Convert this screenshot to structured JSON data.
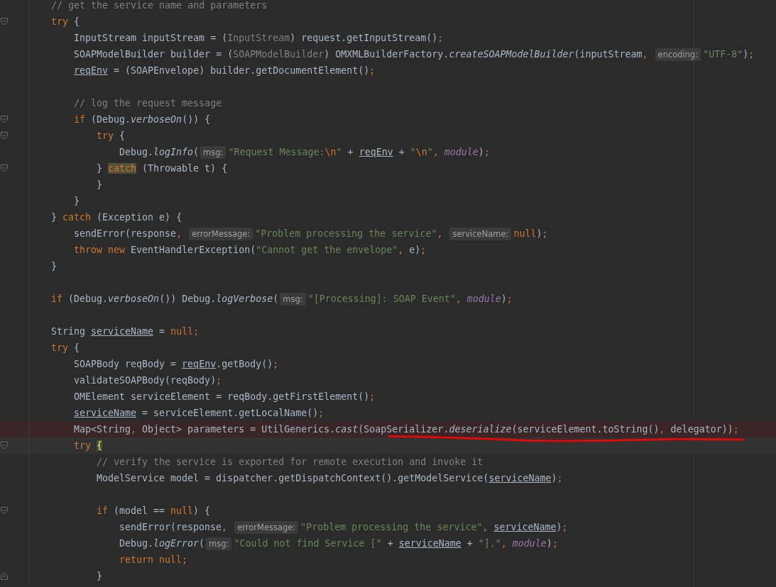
{
  "editor": {
    "lines": [
      {
        "kind": "code",
        "tokens": [
          {
            "kind": "comment",
            "text": "// get the service name and parameters"
          }
        ]
      },
      {
        "kind": "code",
        "fold_open": true,
        "tokens": [
          {
            "kind": "keyword",
            "text": "try"
          },
          {
            "kind": "plain",
            "text": " {"
          }
        ],
        "children": [
          {
            "kind": "code",
            "tokens": [
              {
                "kind": "plain",
                "text": "InputStream inputStream = ("
              },
              {
                "kind": "cast",
                "text": "InputStream"
              },
              {
                "kind": "plain",
                "text": ") request.getInputStream()"
              },
              {
                "kind": "punct",
                "text": ";"
              }
            ]
          },
          {
            "kind": "code",
            "tokens": [
              {
                "kind": "plain",
                "text": "SOAPModelBuilder builder = ("
              },
              {
                "kind": "cast",
                "text": "SOAPModelBuilder"
              },
              {
                "kind": "plain",
                "text": ") OMXMLBuilderFactory."
              },
              {
                "kind": "method",
                "text": "createSOAPModelBuilder"
              },
              {
                "kind": "plain",
                "text": "(inputStream"
              },
              {
                "kind": "punct",
                "text": ", "
              },
              {
                "kind": "hint",
                "text": "encoding:"
              },
              {
                "kind": "string",
                "text": "\"UTF-8\""
              },
              {
                "kind": "plain",
                "text": ")"
              },
              {
                "kind": "punct",
                "text": ";"
              }
            ]
          },
          {
            "kind": "code",
            "tokens": [
              {
                "kind": "underlined",
                "text": "reqEnv"
              },
              {
                "kind": "plain",
                "text": " = (SOAPEnvelope) builder.getDocumentElement()"
              },
              {
                "kind": "punct",
                "text": ";"
              }
            ]
          },
          {
            "kind": "blank"
          },
          {
            "kind": "code",
            "tokens": [
              {
                "kind": "comment",
                "text": "// log the request message"
              }
            ]
          },
          {
            "kind": "code",
            "fold_open": true,
            "tokens": [
              {
                "kind": "keyword",
                "text": "if"
              },
              {
                "kind": "plain",
                "text": " (Debug."
              },
              {
                "kind": "method",
                "text": "verboseOn"
              },
              {
                "kind": "plain",
                "text": "()) {"
              }
            ],
            "children": [
              {
                "kind": "code",
                "fold_open": true,
                "tokens": [
                  {
                    "kind": "keyword",
                    "text": "try"
                  },
                  {
                    "kind": "plain",
                    "text": " {"
                  }
                ],
                "children": [
                  {
                    "kind": "code",
                    "tokens": [
                      {
                        "kind": "plain",
                        "text": "Debug."
                      },
                      {
                        "kind": "method",
                        "text": "logInfo"
                      },
                      {
                        "kind": "plain",
                        "text": "("
                      },
                      {
                        "kind": "hint",
                        "text": "msg:"
                      },
                      {
                        "kind": "string",
                        "text": "\"Request Message:"
                      },
                      {
                        "kind": "escape",
                        "text": "\\n"
                      },
                      {
                        "kind": "string",
                        "text": "\""
                      },
                      {
                        "kind": "plain",
                        "text": " + "
                      },
                      {
                        "kind": "underlined",
                        "text": "reqEnv"
                      },
                      {
                        "kind": "plain",
                        "text": " + "
                      },
                      {
                        "kind": "string",
                        "text": "\""
                      },
                      {
                        "kind": "escape",
                        "text": "\\n"
                      },
                      {
                        "kind": "string",
                        "text": "\""
                      },
                      {
                        "kind": "punct",
                        "text": ", "
                      },
                      {
                        "kind": "field",
                        "text": "module"
                      },
                      {
                        "kind": "plain",
                        "text": ")"
                      },
                      {
                        "kind": "punct",
                        "text": ";"
                      }
                    ]
                  }
                ]
              },
              {
                "kind": "code",
                "fold_open": true,
                "tokens": [
                  {
                    "kind": "plain",
                    "text": "} "
                  },
                  {
                    "kind": "marked",
                    "text": "catch"
                  },
                  {
                    "kind": "plain",
                    "text": " (Throwable t) {"
                  }
                ]
              },
              {
                "kind": "code",
                "tokens": [
                  {
                    "kind": "plain",
                    "text": "}"
                  }
                ]
              }
            ]
          },
          {
            "kind": "code",
            "tokens": [
              {
                "kind": "plain",
                "text": "}"
              }
            ]
          }
        ]
      },
      {
        "kind": "code",
        "tokens": [
          {
            "kind": "plain",
            "text": "} "
          },
          {
            "kind": "keyword",
            "text": "catch"
          },
          {
            "kind": "plain",
            "text": " (Exception e) {"
          }
        ],
        "children": [
          {
            "kind": "code",
            "tokens": [
              {
                "kind": "plain",
                "text": "sendError(response"
              },
              {
                "kind": "punct",
                "text": ", "
              },
              {
                "kind": "hint",
                "text": "errorMessage:"
              },
              {
                "kind": "string",
                "text": "\"Problem processing the service\""
              },
              {
                "kind": "punct",
                "text": ", "
              },
              {
                "kind": "hint",
                "text": "serviceName:"
              },
              {
                "kind": "keyword",
                "text": "null"
              },
              {
                "kind": "plain",
                "text": ")"
              },
              {
                "kind": "punct",
                "text": ";"
              }
            ]
          },
          {
            "kind": "code",
            "tokens": [
              {
                "kind": "keyword",
                "text": "throw new"
              },
              {
                "kind": "plain",
                "text": " EventHandlerException("
              },
              {
                "kind": "string",
                "text": "\"Cannot get the envelope\""
              },
              {
                "kind": "punct",
                "text": ", "
              },
              {
                "kind": "plain",
                "text": "e)"
              },
              {
                "kind": "punct",
                "text": ";"
              }
            ]
          }
        ]
      },
      {
        "kind": "code",
        "tokens": [
          {
            "kind": "plain",
            "text": "}"
          }
        ]
      },
      {
        "kind": "blank"
      },
      {
        "kind": "code",
        "tokens": [
          {
            "kind": "keyword",
            "text": "if"
          },
          {
            "kind": "plain",
            "text": " (Debug."
          },
          {
            "kind": "method",
            "text": "verboseOn"
          },
          {
            "kind": "plain",
            "text": "()) Debug."
          },
          {
            "kind": "method",
            "text": "logVerbose"
          },
          {
            "kind": "plain",
            "text": "("
          },
          {
            "kind": "hint",
            "text": "msg:"
          },
          {
            "kind": "string",
            "text": "\"[Processing]: SOAP Event\""
          },
          {
            "kind": "punct",
            "text": ", "
          },
          {
            "kind": "field",
            "text": "module"
          },
          {
            "kind": "plain",
            "text": ")"
          },
          {
            "kind": "punct",
            "text": ";"
          }
        ]
      },
      {
        "kind": "blank"
      },
      {
        "kind": "code",
        "tokens": [
          {
            "kind": "plain",
            "text": "String "
          },
          {
            "kind": "underlined",
            "text": "serviceName"
          },
          {
            "kind": "plain",
            "text": " = "
          },
          {
            "kind": "keyword",
            "text": "null"
          },
          {
            "kind": "punct",
            "text": ";"
          }
        ]
      },
      {
        "kind": "code",
        "tokens": [
          {
            "kind": "keyword",
            "text": "try"
          },
          {
            "kind": "plain",
            "text": " {"
          }
        ],
        "children": [
          {
            "kind": "code",
            "tokens": [
              {
                "kind": "plain",
                "text": "SOAPBody reqBody = "
              },
              {
                "kind": "underlined",
                "text": "reqEnv"
              },
              {
                "kind": "plain",
                "text": ".getBody()"
              },
              {
                "kind": "punct",
                "text": ";"
              }
            ]
          },
          {
            "kind": "code",
            "tokens": [
              {
                "kind": "plain",
                "text": "validateSOAPBody(reqBody)"
              },
              {
                "kind": "punct",
                "text": ";"
              }
            ]
          },
          {
            "kind": "code",
            "tokens": [
              {
                "kind": "plain",
                "text": "OMElement serviceElement = reqBody.getFirstElement()"
              },
              {
                "kind": "punct",
                "text": ";"
              }
            ]
          },
          {
            "kind": "code",
            "tokens": [
              {
                "kind": "underlined",
                "text": "serviceName"
              },
              {
                "kind": "plain",
                "text": " = serviceElement.getLocalName()"
              },
              {
                "kind": "punct",
                "text": ";"
              }
            ]
          },
          {
            "kind": "error",
            "tokens": [
              {
                "kind": "plain",
                "text": "Map<String"
              },
              {
                "kind": "punct",
                "text": ", "
              },
              {
                "kind": "plain",
                "text": "Object> parameters = UtilGenerics."
              },
              {
                "kind": "method",
                "text": "cast"
              },
              {
                "kind": "plain",
                "text": "(SoapSerializer."
              },
              {
                "kind": "method",
                "text": "deserialize"
              },
              {
                "kind": "plain",
                "text": "(serviceElement.toString()"
              },
              {
                "kind": "punct",
                "text": ", "
              },
              {
                "kind": "plain",
                "text": "delegator))"
              },
              {
                "kind": "punct",
                "text": ";"
              }
            ]
          },
          {
            "kind": "current",
            "fold_open": true,
            "tokens": [
              {
                "kind": "keyword",
                "text": "try"
              },
              {
                "kind": "brace",
                "text": "{"
              }
            ],
            "children": [
              {
                "kind": "code",
                "tokens": [
                  {
                    "kind": "comment",
                    "text": "// verify the service is exported for remote execution and invoke it"
                  }
                ]
              },
              {
                "kind": "code",
                "tokens": [
                  {
                    "kind": "plain",
                    "text": "ModelService model = dispatcher.getDispatchContext().getModelService("
                  },
                  {
                    "kind": "underlined",
                    "text": "serviceName"
                  },
                  {
                    "kind": "plain",
                    "text": ")"
                  },
                  {
                    "kind": "punct",
                    "text": ";"
                  }
                ]
              },
              {
                "kind": "blank"
              },
              {
                "kind": "code",
                "fold_open": true,
                "tokens": [
                  {
                    "kind": "keyword",
                    "text": "if"
                  },
                  {
                    "kind": "plain",
                    "text": " (model == "
                  },
                  {
                    "kind": "keyword",
                    "text": "null"
                  },
                  {
                    "kind": "plain",
                    "text": ") {"
                  }
                ],
                "children": [
                  {
                    "kind": "code",
                    "tokens": [
                      {
                        "kind": "plain",
                        "text": "sendError(response"
                      },
                      {
                        "kind": "punct",
                        "text": ", "
                      },
                      {
                        "kind": "hint",
                        "text": "errorMessage:"
                      },
                      {
                        "kind": "string",
                        "text": "\"Problem processing the service\""
                      },
                      {
                        "kind": "punct",
                        "text": ", "
                      },
                      {
                        "kind": "underlined",
                        "text": "serviceName"
                      },
                      {
                        "kind": "plain",
                        "text": ")"
                      },
                      {
                        "kind": "punct",
                        "text": ";"
                      }
                    ]
                  },
                  {
                    "kind": "code",
                    "tokens": [
                      {
                        "kind": "plain",
                        "text": "Debug."
                      },
                      {
                        "kind": "method",
                        "text": "logError"
                      },
                      {
                        "kind": "plain",
                        "text": "("
                      },
                      {
                        "kind": "hint",
                        "text": "msg:"
                      },
                      {
                        "kind": "string",
                        "text": "\"Could not find Service [\""
                      },
                      {
                        "kind": "plain",
                        "text": " + "
                      },
                      {
                        "kind": "underlined",
                        "text": "serviceName"
                      },
                      {
                        "kind": "plain",
                        "text": " + "
                      },
                      {
                        "kind": "string",
                        "text": "\"].\""
                      },
                      {
                        "kind": "punct",
                        "text": ", "
                      },
                      {
                        "kind": "field",
                        "text": "module"
                      },
                      {
                        "kind": "plain",
                        "text": ")"
                      },
                      {
                        "kind": "punct",
                        "text": ";"
                      }
                    ]
                  },
                  {
                    "kind": "code",
                    "tokens": [
                      {
                        "kind": "keyword",
                        "text": "return null"
                      },
                      {
                        "kind": "punct",
                        "text": ";"
                      }
                    ]
                  }
                ]
              },
              {
                "kind": "code",
                "fold_close": true,
                "tokens": [
                  {
                    "kind": "plain",
                    "text": "}"
                  }
                ]
              }
            ]
          }
        ]
      }
    ]
  }
}
